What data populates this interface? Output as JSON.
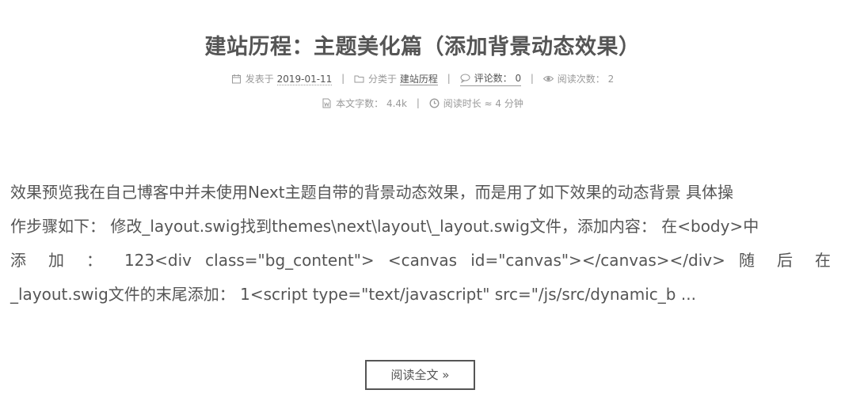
{
  "post": {
    "title": "建站历程：主题美化篇（添加背景动态效果）",
    "meta": {
      "posted_label": "发表于",
      "posted_date": "2019-01-11",
      "category_label": "分类于",
      "category": "建站历程",
      "comments_label": "评论数：",
      "comments_count": "0",
      "views_label": "阅读次数：",
      "views_count": "2",
      "wordcount_label": "本文字数：",
      "wordcount": "4.4k",
      "readtime_label": "阅读时长 ≈",
      "readtime": "4 分钟",
      "separator": "|"
    },
    "excerpt_lines": [
      "效果预览我在自己博客中并未使用Next主题自带的背景动态效果，而是用了如下效果的动态背景 具体操",
      "作步骤如下： 修改_layout.swig找到themes\\next\\layout\\_layout.swig文件，添加内容： 在<body>中",
      "添 加 ： 123<div class=\"bg_content\"> <canvas id=\"canvas\"></canvas></div> 随 后 在",
      "_layout.swig文件的末尾添加： 1<script type=\"text/javascript\" src=\"/js/src/dynamic_b ..."
    ],
    "read_more_label": "阅读全文 »"
  },
  "icons": {
    "calendar": "calendar-icon",
    "folder": "folder-icon",
    "comment": "comment-icon",
    "eye": "eye-icon",
    "file": "file-word-icon",
    "clock": "clock-icon"
  },
  "colors": {
    "text": "#555555",
    "meta": "#999999",
    "background": "#ffffff"
  }
}
